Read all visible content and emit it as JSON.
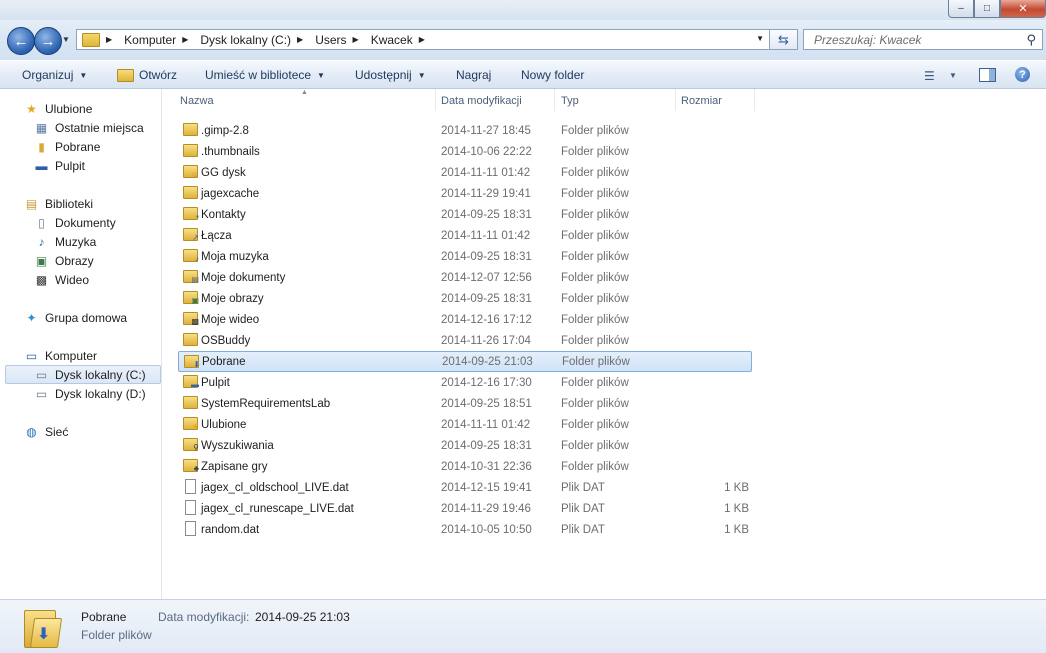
{
  "window": {
    "minimize_glyph": "–",
    "maximize_glyph": "□",
    "close_glyph": "✕"
  },
  "nav": {
    "back_glyph": "←",
    "forward_glyph": "→",
    "breadcrumb": [
      "Komputer",
      "Dysk lokalny (C:)",
      "Users",
      "Kwacek"
    ],
    "search_placeholder": "Przeszukaj: Kwacek"
  },
  "toolbar": {
    "organize": "Organizuj",
    "open": "Otwórz",
    "include_in_library": "Umieść w bibliotece",
    "share": "Udostępnij",
    "burn": "Nagraj",
    "new_folder": "Nowy folder"
  },
  "sidebar": {
    "favorites": "Ulubione",
    "recent": "Ostatnie miejsca",
    "downloads": "Pobrane",
    "desktop": "Pulpit",
    "libraries": "Biblioteki",
    "documents": "Dokumenty",
    "music": "Muzyka",
    "pictures": "Obrazy",
    "videos": "Wideo",
    "homegroup": "Grupa domowa",
    "computer": "Komputer",
    "drive_c": "Dysk lokalny (C:)",
    "drive_d": "Dysk lokalny (D:)",
    "network": "Sieć"
  },
  "columns": {
    "name": "Nazwa",
    "date": "Data modyfikacji",
    "type": "Typ",
    "size": "Rozmiar"
  },
  "files": [
    {
      "name": ".gimp-2.8",
      "date": "2014-11-27 18:45",
      "type": "Folder plików",
      "size": "",
      "icon": "folder-icon"
    },
    {
      "name": ".thumbnails",
      "date": "2014-10-06 22:22",
      "type": "Folder plików",
      "size": "",
      "icon": "folder-icon"
    },
    {
      "name": "GG dysk",
      "date": "2014-11-11 01:42",
      "type": "Folder plików",
      "size": "",
      "icon": "gg-disk-icon"
    },
    {
      "name": "jagexcache",
      "date": "2014-11-29 19:41",
      "type": "Folder plików",
      "size": "",
      "icon": "folder-icon"
    },
    {
      "name": "Kontakty",
      "date": "2014-09-25 18:31",
      "type": "Folder plików",
      "size": "",
      "icon": "contacts-folder-icon"
    },
    {
      "name": "Łącza",
      "date": "2014-11-11 01:42",
      "type": "Folder plików",
      "size": "",
      "icon": "links-folder-icon"
    },
    {
      "name": "Moja muzyka",
      "date": "2014-09-25 18:31",
      "type": "Folder plików",
      "size": "",
      "icon": "music-folder-icon"
    },
    {
      "name": "Moje dokumenty",
      "date": "2014-12-07 12:56",
      "type": "Folder plików",
      "size": "",
      "icon": "documents-folder-icon"
    },
    {
      "name": "Moje obrazy",
      "date": "2014-09-25 18:31",
      "type": "Folder plików",
      "size": "",
      "icon": "pictures-folder-icon"
    },
    {
      "name": "Moje wideo",
      "date": "2014-12-16 17:12",
      "type": "Folder plików",
      "size": "",
      "icon": "videos-folder-icon"
    },
    {
      "name": "OSBuddy",
      "date": "2014-11-26 17:04",
      "type": "Folder plików",
      "size": "",
      "icon": "folder-icon"
    },
    {
      "name": "Pobrane",
      "date": "2014-09-25 21:03",
      "type": "Folder plików",
      "size": "",
      "icon": "downloads-folder-icon"
    },
    {
      "name": "Pulpit",
      "date": "2014-12-16 17:30",
      "type": "Folder plików",
      "size": "",
      "icon": "desktop-folder-icon"
    },
    {
      "name": "SystemRequirementsLab",
      "date": "2014-09-25 18:51",
      "type": "Folder plików",
      "size": "",
      "icon": "folder-icon"
    },
    {
      "name": "Ulubione",
      "date": "2014-11-11 01:42",
      "type": "Folder plików",
      "size": "",
      "icon": "favorites-folder-icon"
    },
    {
      "name": "Wyszukiwania",
      "date": "2014-09-25 18:31",
      "type": "Folder plików",
      "size": "",
      "icon": "searches-folder-icon"
    },
    {
      "name": "Zapisane gry",
      "date": "2014-10-31 22:36",
      "type": "Folder plików",
      "size": "",
      "icon": "saved-games-folder-icon"
    },
    {
      "name": "jagex_cl_oldschool_LIVE.dat",
      "date": "2014-12-15 19:41",
      "type": "Plik DAT",
      "size": "1 KB",
      "icon": "file-icon"
    },
    {
      "name": "jagex_cl_runescape_LIVE.dat",
      "date": "2014-11-29 19:46",
      "type": "Plik DAT",
      "size": "1 KB",
      "icon": "file-icon"
    },
    {
      "name": "random.dat",
      "date": "2014-10-05 10:50",
      "type": "Plik DAT",
      "size": "1 KB",
      "icon": "file-icon"
    }
  ],
  "selected_index": 11,
  "details": {
    "name": "Pobrane",
    "date_label": "Data modyfikacji:",
    "date_value": "2014-09-25 21:03",
    "type": "Folder plików"
  }
}
